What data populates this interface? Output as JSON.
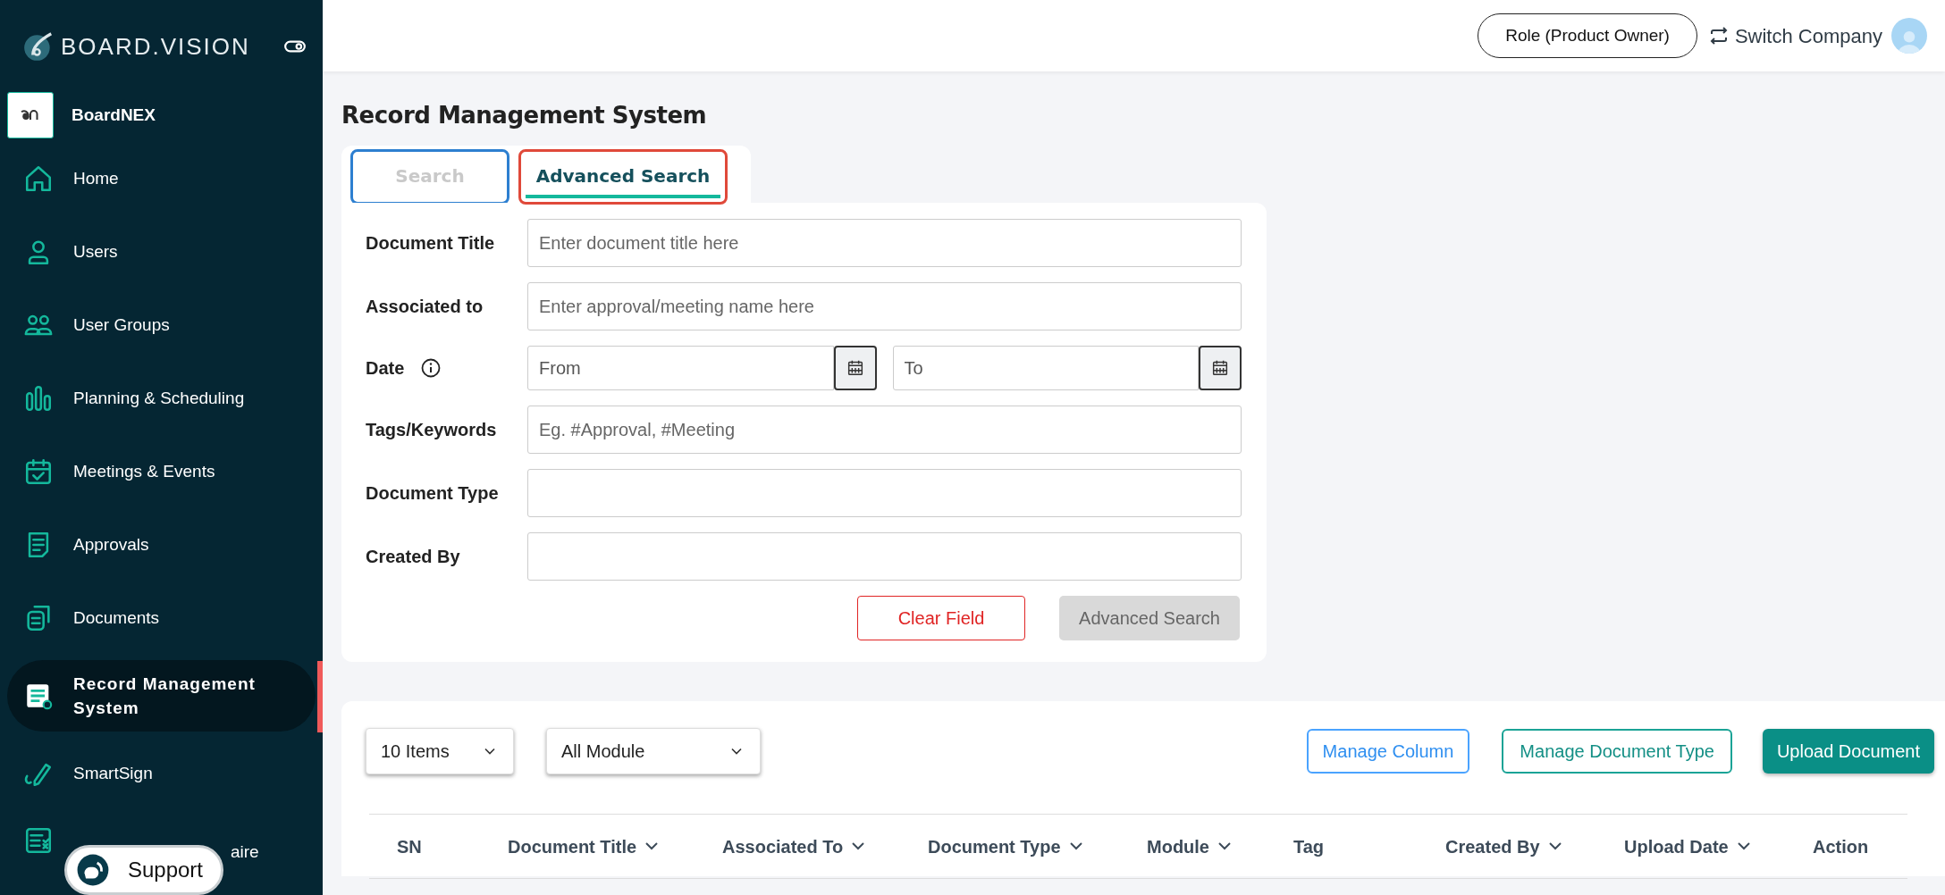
{
  "sidebar": {
    "brand": "BOARD.VISION",
    "company": "BoardNEX",
    "items": [
      {
        "label": "Home",
        "selected": false
      },
      {
        "label": "Users",
        "selected": false
      },
      {
        "label": "User Groups",
        "selected": false
      },
      {
        "label": "Planning & Scheduling",
        "selected": false
      },
      {
        "label": "Meetings & Events",
        "selected": false
      },
      {
        "label": "Approvals",
        "selected": false
      },
      {
        "label": "Documents",
        "selected": false
      },
      {
        "label": "Record Management System",
        "selected": true
      },
      {
        "label": "SmartSign",
        "selected": false
      },
      {
        "label": "aire",
        "selected": false,
        "kind": "covered"
      }
    ],
    "support": "Support"
  },
  "header": {
    "role": "Role (Product Owner)",
    "switch": "Switch Company"
  },
  "page_title": "Record Management System",
  "tabs": [
    {
      "label": "Search",
      "selected": false
    },
    {
      "label": "Advanced Search",
      "selected": true
    }
  ],
  "form": {
    "fields": [
      {
        "kind": "text",
        "label": "Document Title",
        "placeholder": "Enter document title here"
      },
      {
        "kind": "text",
        "label": "Associated to",
        "placeholder": "Enter approval/meeting name here"
      },
      {
        "kind": "daterange",
        "label": "Date",
        "range": [
          {
            "placeholder": "From"
          },
          {
            "placeholder": "To"
          }
        ]
      },
      {
        "kind": "text",
        "label": "Tags/Keywords",
        "placeholder": "Eg. #Approval, #Meeting"
      },
      {
        "kind": "text",
        "label": "Document Type"
      },
      {
        "kind": "text",
        "label": "Created By"
      }
    ],
    "clear": "Clear Field",
    "submit": {
      "label": "Advanced Search",
      "disabled": true
    }
  },
  "toolbar": {
    "page_size": "10 Items",
    "module": "All Module",
    "buttons": [
      {
        "label": "Manage Column",
        "kind": "outline-blue"
      },
      {
        "label": "Manage Document Type",
        "kind": "outline-teal"
      },
      {
        "label": "Upload Document",
        "kind": "solid"
      }
    ]
  },
  "table": {
    "columns": [
      {
        "label": "SN",
        "kind": "plain"
      },
      {
        "label": "Document Title",
        "kind": "sort"
      },
      {
        "label": "Associated To",
        "kind": "sort"
      },
      {
        "label": "Document Type",
        "kind": "sort"
      },
      {
        "label": "Module",
        "kind": "sort"
      },
      {
        "label": "Tag",
        "kind": "plain"
      },
      {
        "label": "Created By",
        "kind": "sort"
      },
      {
        "label": "Upload Date",
        "kind": "sort"
      },
      {
        "label": "Action",
        "kind": "plain"
      }
    ]
  }
}
